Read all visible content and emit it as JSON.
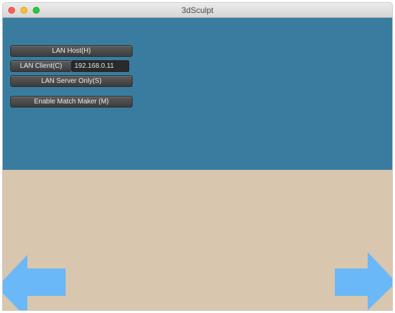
{
  "window": {
    "title": "3dSculpt"
  },
  "menu": {
    "lan_host_label": "LAN Host(H)",
    "lan_client_label": "LAN Client(C)",
    "client_address_value": "192.168.0.11",
    "lan_server_label": "LAN Server Only(S)",
    "match_maker_label": "Enable Match Maker (M)"
  },
  "controls": {
    "left_arrow_icon": "left-arrow-icon",
    "right_arrow_icon": "right-arrow-icon"
  },
  "colors": {
    "sky": "#3a7c9f",
    "ground": "#d9c6ae",
    "arrow": "#6ab8f7",
    "button": "#4a4a4a"
  }
}
